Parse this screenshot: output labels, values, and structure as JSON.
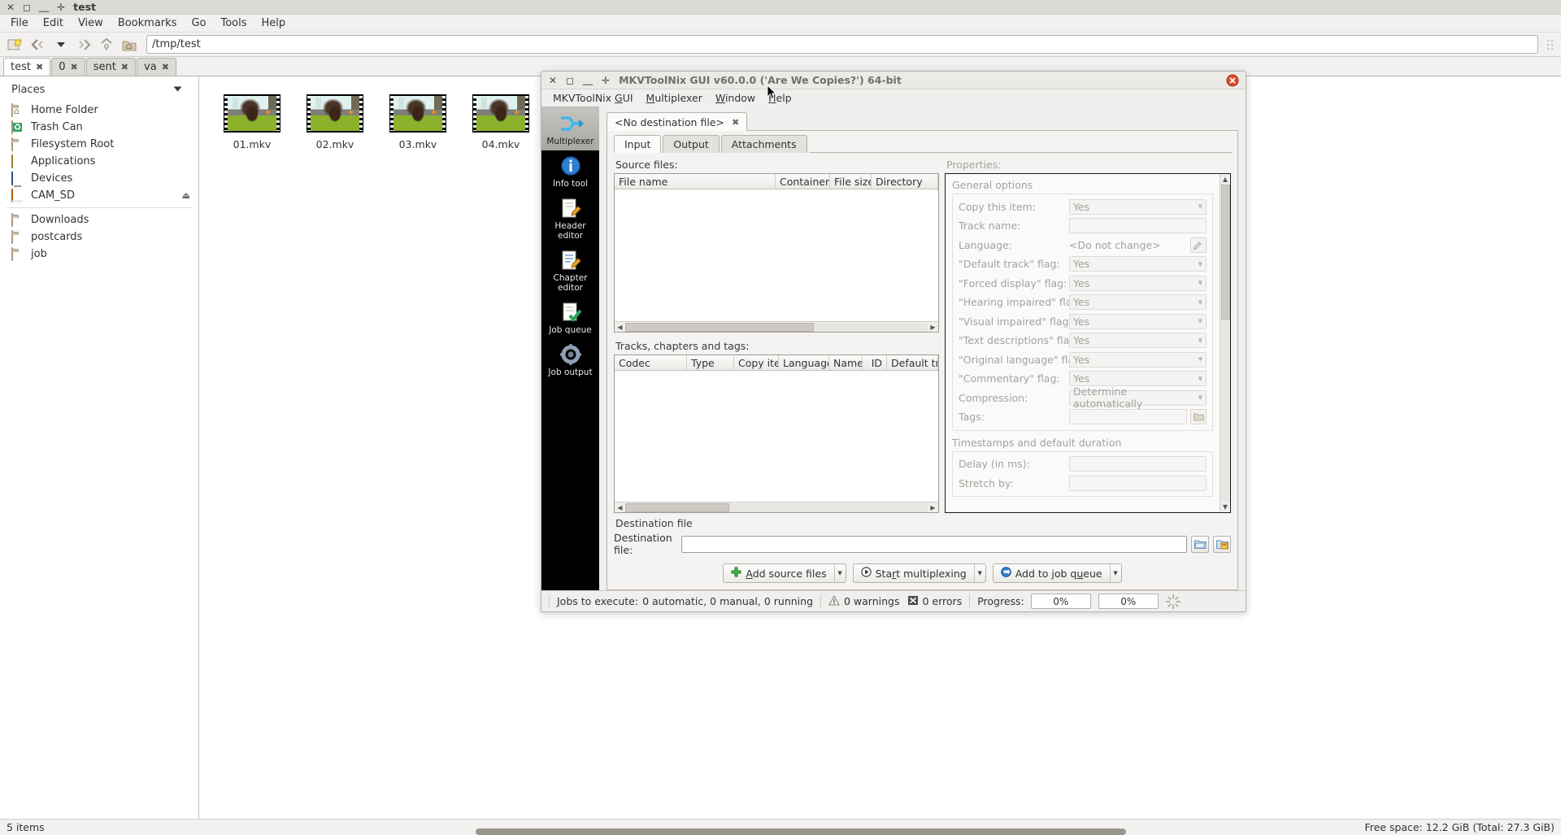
{
  "filemanager": {
    "window_title": "test",
    "window_buttons": [
      "close",
      "maximize",
      "minimize",
      "shade"
    ],
    "menus": [
      "File",
      "Edit",
      "View",
      "Bookmarks",
      "Go",
      "Tools",
      "Help"
    ],
    "toolbar": {
      "new_tab_icon": "new-tab-icon",
      "back_icon": "back-icon",
      "history_dropdown_icon": "chevron-down-icon",
      "forward_icon": "forward-icon",
      "up_icon": "go-up-icon",
      "home_icon": "home-folder-icon"
    },
    "path": "/tmp/test",
    "tabs": [
      {
        "label": "test",
        "active": true
      },
      {
        "label": "0",
        "active": false
      },
      {
        "label": "sent",
        "active": false
      },
      {
        "label": "va",
        "active": false
      }
    ],
    "sidebar": {
      "heading": "Places",
      "collapse_icon": "chevron-down-icon",
      "items": [
        {
          "label": "Home Folder",
          "icon": "home-folder-icon"
        },
        {
          "label": "Trash Can",
          "icon": "trash-can-icon"
        },
        {
          "label": "Filesystem Root",
          "icon": "folder-icon"
        },
        {
          "label": "Applications",
          "icon": "applications-icon"
        },
        {
          "label": "Devices",
          "icon": "devices-icon"
        },
        {
          "label": "CAM_SD",
          "icon": "removable-media-icon",
          "eject": "⏏"
        }
      ],
      "bookmarks": [
        {
          "label": "Downloads",
          "icon": "folder-icon"
        },
        {
          "label": "postcards",
          "icon": "folder-icon"
        },
        {
          "label": "job",
          "icon": "folder-icon"
        }
      ]
    },
    "files": [
      {
        "name": "01.mkv",
        "icon": "video-thumbnail"
      },
      {
        "name": "02.mkv",
        "icon": "video-thumbnail"
      },
      {
        "name": "03.mkv",
        "icon": "video-thumbnail"
      },
      {
        "name": "04.mkv",
        "icon": "video-thumbnail"
      }
    ],
    "status": {
      "left": "5 items",
      "right": "Free space: 12.2 GiB (Total: 27.3 GiB)"
    }
  },
  "mkvtoolnix": {
    "window_title": "MKVToolNix GUI v60.0.0 ('Are We Copies?') 64-bit",
    "window_buttons": [
      "close",
      "maximize",
      "minimize",
      "shade"
    ],
    "warning_icon": "warning-icon",
    "menus": [
      "MKVToolNix GUI",
      "Multiplexer",
      "Window",
      "Help"
    ],
    "rail": [
      {
        "label": "Multiplexer",
        "icon": "multiplexer-icon",
        "selected": true
      },
      {
        "label": "Info tool",
        "icon": "info-tool-icon",
        "selected": false
      },
      {
        "label": "Header editor",
        "icon": "header-editor-icon",
        "selected": false
      },
      {
        "label": "Chapter editor",
        "icon": "chapter-editor-icon",
        "selected": false
      },
      {
        "label": "Job queue",
        "icon": "job-queue-icon",
        "selected": false
      },
      {
        "label": "Job output",
        "icon": "job-output-icon",
        "selected": false
      }
    ],
    "document_tab": {
      "label": "<No destination file>",
      "close_icon": "close-icon"
    },
    "tabs": [
      {
        "label": "Input",
        "active": true
      },
      {
        "label": "Output",
        "active": false
      },
      {
        "label": "Attachments",
        "active": false
      }
    ],
    "source_files": {
      "label": "Source files:",
      "columns": [
        "File name",
        "Container",
        "File size",
        "Directory"
      ],
      "rows": []
    },
    "tracks": {
      "label": "Tracks, chapters and tags:",
      "columns": [
        "Codec",
        "Type",
        "Copy item",
        "Language",
        "Name",
        "ID",
        "Default trac"
      ],
      "rows": []
    },
    "properties": {
      "label": "Properties:",
      "groups": [
        {
          "title": "General options",
          "rows": [
            {
              "label": "Copy this item:",
              "value": "Yes",
              "control": "combobox"
            },
            {
              "label": "Track name:",
              "value": "",
              "control": "textbox"
            },
            {
              "label": "Language:",
              "value": "<Do not change>",
              "control": "language",
              "button_icon": "edit-icon"
            },
            {
              "label": "\"Default track\" flag:",
              "value": "Yes",
              "control": "combobox"
            },
            {
              "label": "\"Forced display\" flag:",
              "value": "Yes",
              "control": "combobox"
            },
            {
              "label": "\"Hearing impaired\" flag:",
              "value": "Yes",
              "control": "combobox"
            },
            {
              "label": "\"Visual impaired\" flag:",
              "value": "Yes",
              "control": "combobox"
            },
            {
              "label": "\"Text descriptions\" flag:",
              "value": "Yes",
              "control": "combobox"
            },
            {
              "label": "\"Original language\" flag:",
              "value": "Yes",
              "control": "combobox"
            },
            {
              "label": "\"Commentary\" flag:",
              "value": "Yes",
              "control": "combobox"
            },
            {
              "label": "Compression:",
              "value": "Determine automatically",
              "control": "combobox"
            },
            {
              "label": "Tags:",
              "value": "",
              "control": "textbox",
              "button_icon": "folder-open-icon"
            }
          ]
        },
        {
          "title": "Timestamps and default duration",
          "rows": [
            {
              "label": "Delay (in ms):",
              "value": "",
              "control": "textbox"
            },
            {
              "label": "Stretch by:",
              "value": "",
              "control": "textbox"
            }
          ]
        }
      ]
    },
    "destination": {
      "section_label": "Destination file",
      "field_label": "Destination file:",
      "value": "",
      "browse_icon": "folder-open-icon",
      "recent_icon": "recent-folders-icon"
    },
    "actions": [
      {
        "label": "Add source files",
        "icon": "plus-icon",
        "has_dropdown": true
      },
      {
        "label": "Start multiplexing",
        "icon": "play-icon",
        "has_dropdown": true
      },
      {
        "label": "Add to job queue",
        "icon": "add-job-icon",
        "has_dropdown": true
      }
    ],
    "statusbar": {
      "jobs_label": "Jobs to execute:",
      "jobs_value": "0 automatic, 0 manual, 0 running",
      "warnings_icon": "warning-icon",
      "warnings": "0 warnings",
      "errors_icon": "error-icon",
      "errors": "0 errors",
      "progress_label": "Progress:",
      "progress_1": "0%",
      "progress_2": "0%",
      "busy_icon": "busy-spinner-icon"
    }
  },
  "colors": {
    "desktop_chrome": "#f2f1f0",
    "titlebar": "#dcdad5",
    "rail_dark": "#000000",
    "accent_green": "#2aa25c",
    "accent_orange": "#f08a24",
    "disabled_text": "#a5a29c"
  }
}
